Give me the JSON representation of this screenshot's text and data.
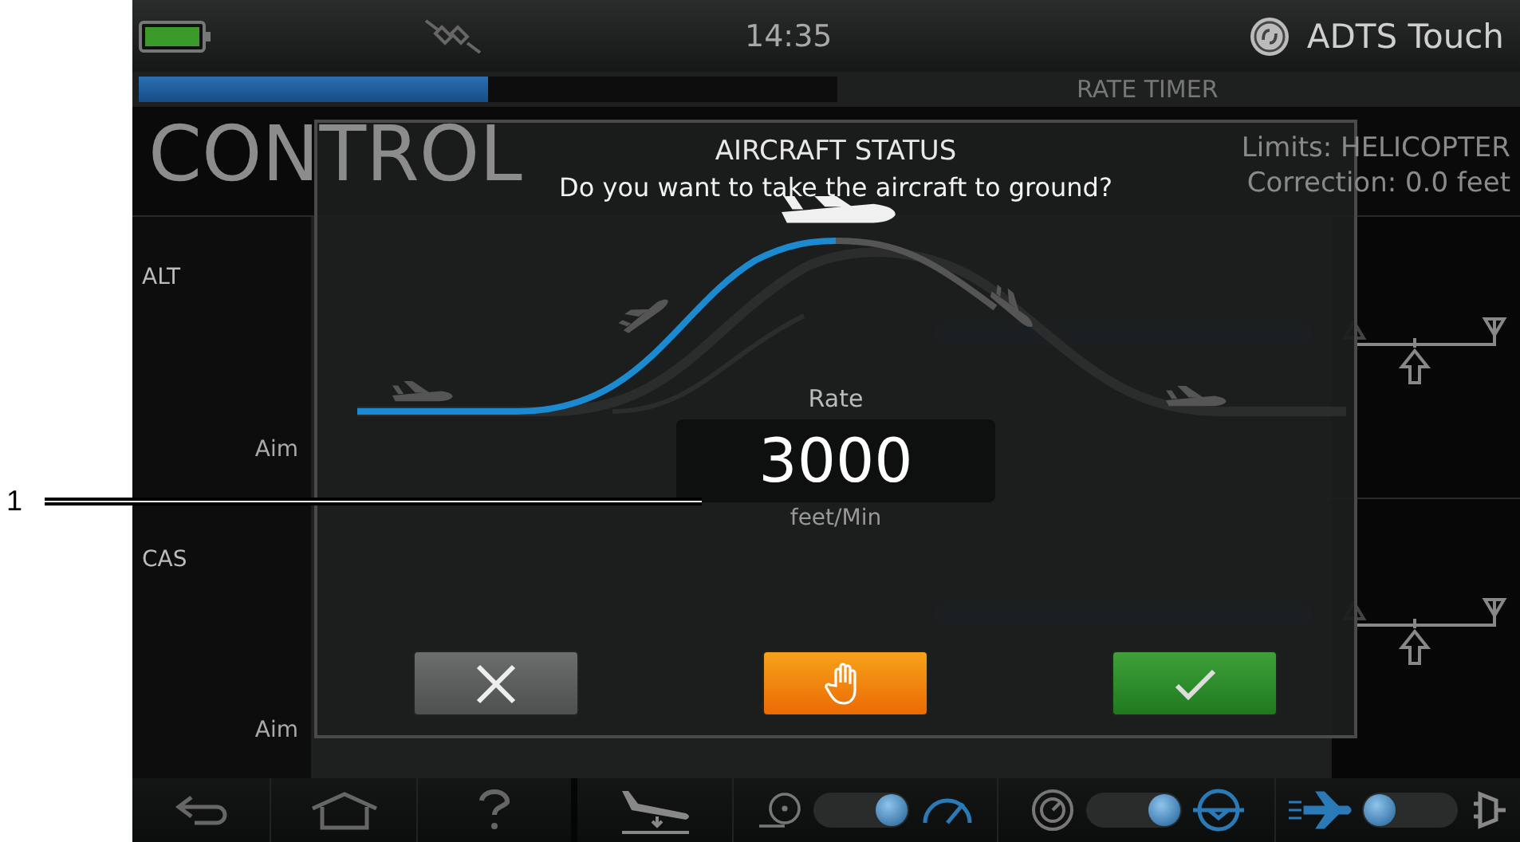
{
  "callout": {
    "label": "1"
  },
  "status_bar": {
    "time": "14:35",
    "product": "ADTS Touch"
  },
  "progress": {
    "level": 0.5,
    "label": "RATE TIMER"
  },
  "header": {
    "title": "CONTROL",
    "limits": "Limits: HELICOPTER",
    "correction": "Correction: 0.0 feet"
  },
  "channels": [
    {
      "name": "ALT",
      "aim_label": "Aim",
      "level": 1
    },
    {
      "name": "CAS",
      "aim_label": "Aim",
      "level": 1
    }
  ],
  "dialog": {
    "title": "AIRCRAFT STATUS",
    "message": "Do you want to take the aircraft to ground?",
    "rate_label": "Rate",
    "rate_value": "3000",
    "rate_unit": "feet/Min",
    "buttons": [
      {
        "kind": "cancel"
      },
      {
        "kind": "hold"
      },
      {
        "kind": "confirm"
      }
    ]
  },
  "toolbar": {
    "toggles": [
      {
        "on": true
      },
      {
        "on": true
      },
      {
        "on": false
      }
    ]
  }
}
